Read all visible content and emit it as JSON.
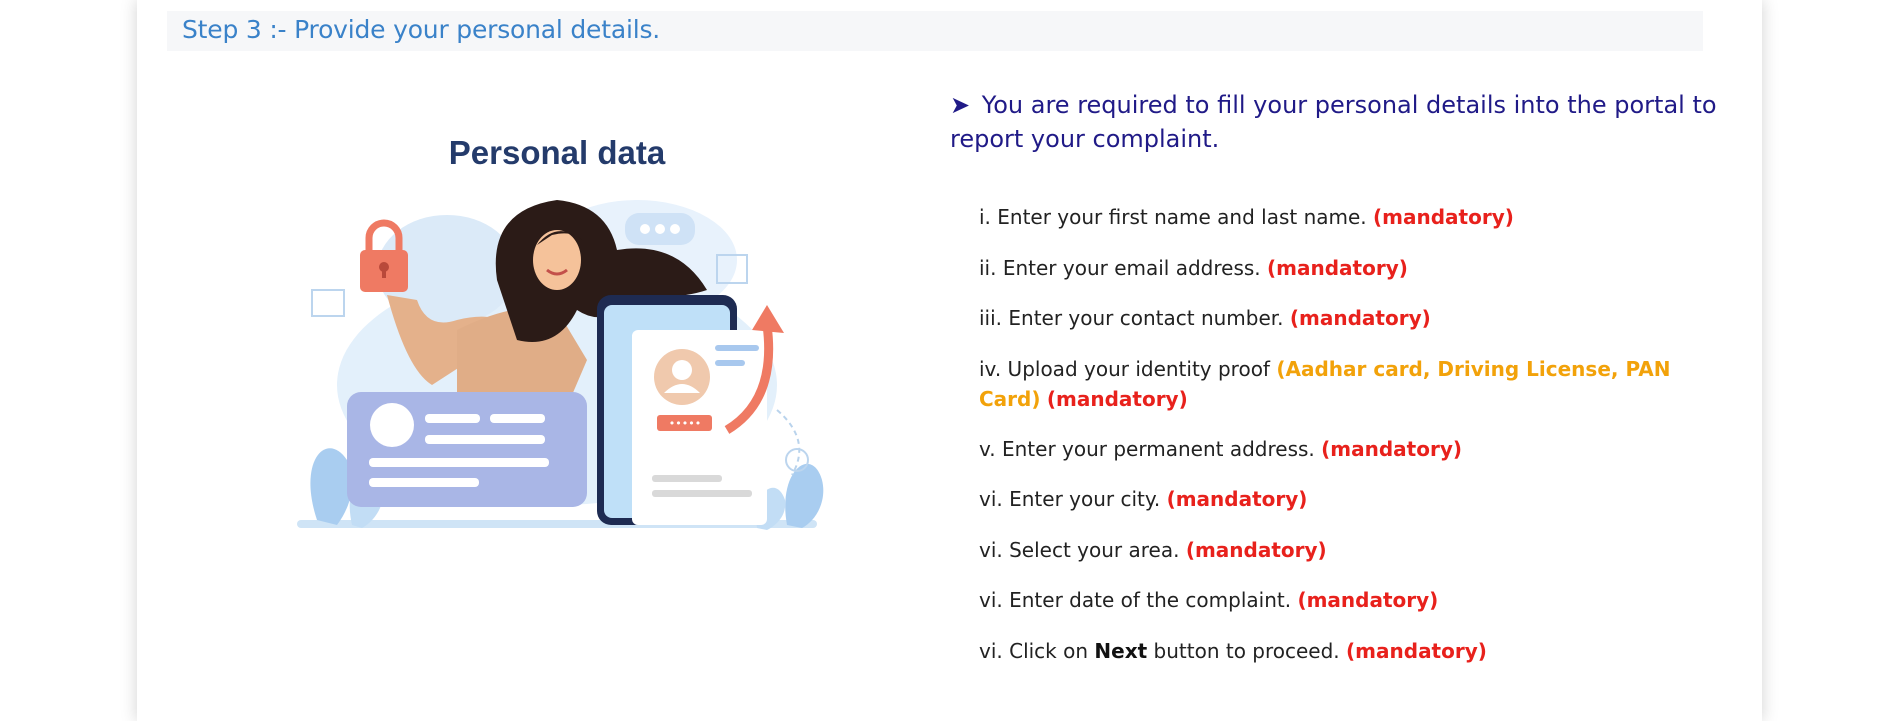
{
  "step": {
    "title": "Step 3 :- Provide your personal details."
  },
  "illustration": {
    "title": "Personal data",
    "form_dots": "•••••"
  },
  "intro": {
    "arrow": "➤",
    "text": "You are required to fill your personal details into the portal to report your complaint."
  },
  "steps": [
    {
      "prefix": "i. Enter your first name and last name.",
      "tag": "(mandatory)"
    },
    {
      "prefix": "ii. Enter your email address.",
      "tag": "(mandatory)"
    },
    {
      "prefix": "iii. Enter your contact number.",
      "tag": "(mandatory)"
    },
    {
      "prefix": "iv. Upload your identity proof",
      "docs": "(Aadhar card, Driving License, PAN Card)",
      "tag": "(mandatory)"
    },
    {
      "prefix": "v. Enter your permanent address.",
      "tag": "(mandatory)"
    },
    {
      "prefix": "vi. Enter your city.",
      "tag": "(mandatory)"
    },
    {
      "prefix": "vi. Select your area.",
      "tag": "(mandatory)"
    },
    {
      "prefix": "vi. Enter date of the complaint.",
      "tag": "(mandatory)"
    },
    {
      "prefix": "vi. Click on",
      "bold": "Next",
      "suffix": "button to proceed.",
      "tag": "(mandatory)"
    }
  ],
  "colors": {
    "header_text": "#3a82c9",
    "intro_text": "#201a87",
    "mandatory": "#e8211c",
    "docs": "#f2a20a"
  }
}
